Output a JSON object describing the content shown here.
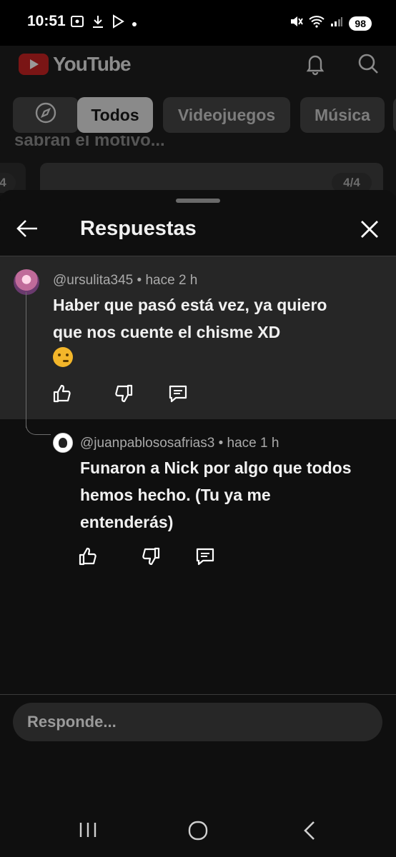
{
  "status_bar": {
    "time": "10:51",
    "battery": "98"
  },
  "header": {
    "logo_text": "YouTube"
  },
  "chips": [
    "Todos",
    "Videojuegos",
    "Música"
  ],
  "background": {
    "partial_text": "sabrán el motivo...",
    "pager_left": "4",
    "pager_right": "4/4"
  },
  "sheet": {
    "title": "Respuestas"
  },
  "parent_comment": {
    "author": "@ursulita345",
    "time": "hace 2 h",
    "text_line1": "Haber que pasó está vez, ya quiero",
    "text_line2": "que nos cuente el chisme XD",
    "emoji": "thinking-face"
  },
  "reply_comment": {
    "author": "@juanpablososafrias3",
    "time": "hace 1 h",
    "text_line1": "Funaron a Nick por algo que todos",
    "text_line2": "hemos hecho. (Tu ya me",
    "text_line3": "entenderás)"
  },
  "reply_box": {
    "placeholder": "Responde..."
  },
  "colors": {
    "brand_red": "#ff0000",
    "sheet_bg": "#0f0f0f",
    "highlight_bg": "#262626"
  }
}
